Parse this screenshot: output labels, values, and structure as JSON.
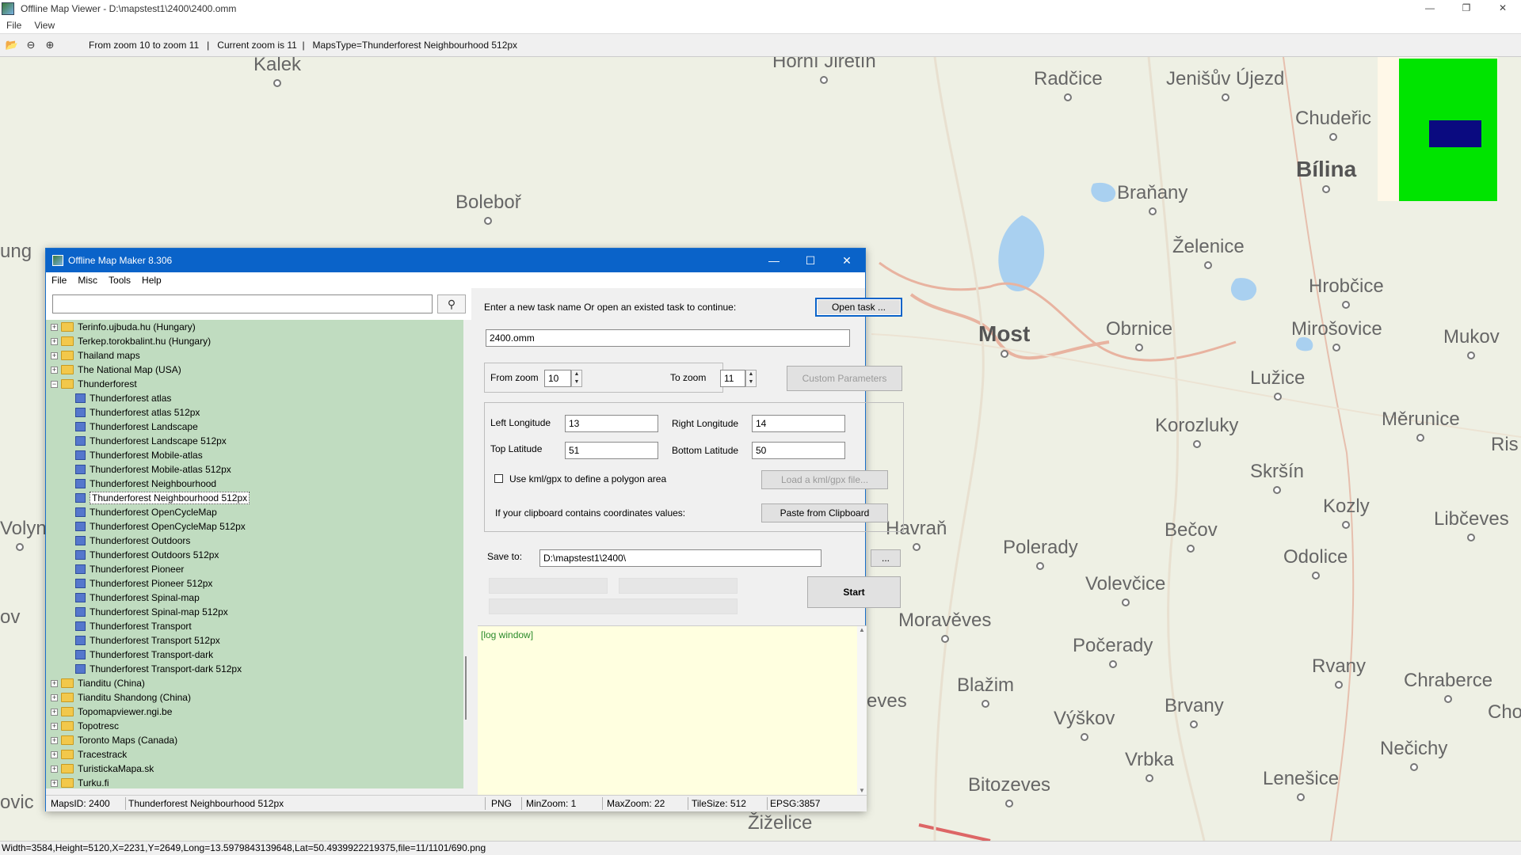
{
  "viewer": {
    "title": "Offline Map Viewer - D:\\mapstest1\\2400\\2400.omm",
    "menu": [
      "File",
      "View"
    ],
    "toolbar_status": "From zoom 10 to zoom 11   |   Current zoom is 11  |   MapsType=Thunderforest Neighbourhood 512px",
    "status_bar": "Width=3584,Height=5120,X=2231,Y=2649,Long=13.5979843139648,Lat=50.4939922219375,file=11/1101/690.png",
    "places": [
      {
        "name": "Kalek",
        "big": false
      },
      {
        "name": "Hořní Jiřetín",
        "big": false
      },
      {
        "name": "Radčice",
        "big": false
      },
      {
        "name": "Jenišův Újezd",
        "big": false
      },
      {
        "name": "Chudeřic",
        "big": false
      },
      {
        "name": "Bílina",
        "big": true
      },
      {
        "name": "Boleboř",
        "big": false
      },
      {
        "name": "Braňany",
        "big": false
      },
      {
        "name": "Želenice",
        "big": false
      },
      {
        "name": "Hrobčice",
        "big": false
      },
      {
        "name": "Most",
        "big": true
      },
      {
        "name": "Obrnice",
        "big": false
      },
      {
        "name": "Mirošovice",
        "big": false
      },
      {
        "name": "Mukov",
        "big": false
      },
      {
        "name": "Lužice",
        "big": false
      },
      {
        "name": "Korozluky",
        "big": false
      },
      {
        "name": "Měrunice",
        "big": false
      },
      {
        "name": "Skršín",
        "big": false
      },
      {
        "name": "Kozly",
        "big": false
      },
      {
        "name": "Havraň",
        "big": false
      },
      {
        "name": "Polerady",
        "big": false
      },
      {
        "name": "Bečov",
        "big": false
      },
      {
        "name": "Libčeves",
        "big": false
      },
      {
        "name": "Volevčice",
        "big": false
      },
      {
        "name": "Odolice",
        "big": false
      },
      {
        "name": "Moravěves",
        "big": false
      },
      {
        "name": "Počerady",
        "big": false
      },
      {
        "name": "Blažim",
        "big": false
      },
      {
        "name": "Rvany",
        "big": false
      },
      {
        "name": "Chraberce",
        "big": false
      },
      {
        "name": "Výškov",
        "big": false
      },
      {
        "name": "Brvany",
        "big": false
      },
      {
        "name": "Vrbka",
        "big": false
      },
      {
        "name": "Nečichy",
        "big": false
      },
      {
        "name": "Bitozeves",
        "big": false
      },
      {
        "name": "Lenešice",
        "big": false
      },
      {
        "name": "Žiželice",
        "big": false
      },
      {
        "name": "Volyn",
        "big": false
      },
      {
        "name": "ung",
        "big": false
      },
      {
        "name": "eves",
        "big": false
      },
      {
        "name": "Ris",
        "big": false
      },
      {
        "name": "Cho",
        "big": false
      },
      {
        "name": "ov",
        "big": false
      },
      {
        "name": "ovic",
        "big": false
      }
    ]
  },
  "maker": {
    "title": "Offline Map Maker 8.306",
    "menu": [
      "File",
      "Misc",
      "Tools",
      "Help"
    ],
    "search": {
      "value": "",
      "placeholder": ""
    },
    "tree": [
      {
        "label": "Terinfo.ujbuda.hu (Hungary)",
        "type": "folder",
        "exp": "+"
      },
      {
        "label": "Terkep.torokbalint.hu (Hungary)",
        "type": "folder",
        "exp": "+"
      },
      {
        "label": "Thailand maps",
        "type": "folder",
        "exp": "+"
      },
      {
        "label": "The National Map (USA)",
        "type": "folder",
        "exp": "+"
      },
      {
        "label": "Thunderforest",
        "type": "folder",
        "exp": "−"
      },
      {
        "label": "Thunderforest atlas",
        "type": "leaf"
      },
      {
        "label": "Thunderforest atlas 512px",
        "type": "leaf"
      },
      {
        "label": "Thunderforest Landscape",
        "type": "leaf"
      },
      {
        "label": "Thunderforest Landscape 512px",
        "type": "leaf"
      },
      {
        "label": "Thunderforest Mobile-atlas",
        "type": "leaf"
      },
      {
        "label": "Thunderforest Mobile-atlas 512px",
        "type": "leaf"
      },
      {
        "label": "Thunderforest Neighbourhood",
        "type": "leaf"
      },
      {
        "label": "Thunderforest Neighbourhood 512px",
        "type": "leaf",
        "selected": true
      },
      {
        "label": "Thunderforest OpenCycleMap",
        "type": "leaf"
      },
      {
        "label": "Thunderforest OpenCycleMap 512px",
        "type": "leaf"
      },
      {
        "label": "Thunderforest Outdoors",
        "type": "leaf"
      },
      {
        "label": "Thunderforest Outdoors 512px",
        "type": "leaf"
      },
      {
        "label": "Thunderforest Pioneer",
        "type": "leaf"
      },
      {
        "label": "Thunderforest Pioneer 512px",
        "type": "leaf"
      },
      {
        "label": "Thunderforest Spinal-map",
        "type": "leaf"
      },
      {
        "label": "Thunderforest Spinal-map 512px",
        "type": "leaf"
      },
      {
        "label": "Thunderforest Transport",
        "type": "leaf"
      },
      {
        "label": "Thunderforest Transport 512px",
        "type": "leaf"
      },
      {
        "label": "Thunderforest Transport-dark",
        "type": "leaf"
      },
      {
        "label": "Thunderforest Transport-dark 512px",
        "type": "leaf"
      },
      {
        "label": "Tianditu (China)",
        "type": "folder",
        "exp": "+"
      },
      {
        "label": "Tianditu Shandong (China)",
        "type": "folder",
        "exp": "+"
      },
      {
        "label": "Topomapviewer.ngi.be",
        "type": "folder",
        "exp": "+"
      },
      {
        "label": "Topotresc",
        "type": "folder",
        "exp": "+"
      },
      {
        "label": "Toronto Maps (Canada)",
        "type": "folder",
        "exp": "+"
      },
      {
        "label": "Tracestrack",
        "type": "folder",
        "exp": "+"
      },
      {
        "label": "TuristickaMapa.sk",
        "type": "folder",
        "exp": "+"
      },
      {
        "label": "Turku.fi",
        "type": "folder",
        "exp": "+"
      }
    ],
    "form": {
      "task_prompt": "Enter a new task name Or open an existed task to continue:",
      "open_task": "Open task ...",
      "task_name": "2400.omm",
      "from_zoom_label": "From zoom",
      "from_zoom": "10",
      "to_zoom_label": "To zoom",
      "to_zoom": "11",
      "custom_params": "Custom Parameters",
      "left_lon_label": "Left Longitude",
      "left_lon": "13",
      "right_lon_label": "Right Longitude",
      "right_lon": "14",
      "top_lat_label": "Top Latitude",
      "top_lat": "51",
      "bottom_lat_label": "Bottom Latitude",
      "bottom_lat": "50",
      "kml_label": "Use kml/gpx to define a polygon area",
      "kml_btn": "Load a kml/gpx file...",
      "clipboard_label": "If your clipboard contains coordinates values:",
      "clipboard_btn": "Paste from Clipboard",
      "save_label": "Save to:",
      "save_path": "D:\\mapstest1\\2400\\",
      "browse_btn": "...",
      "start_btn": "Start"
    },
    "log": "[log window]",
    "status": {
      "maps_id": "MapsID: 2400",
      "map_name": "Thunderforest Neighbourhood 512px",
      "format": "PNG",
      "min_zoom": "MinZoom: 1",
      "max_zoom": "MaxZoom: 22",
      "tile_size": "TileSize: 512",
      "epsg": "EPSG:3857"
    }
  },
  "colors": {
    "dialog_title": "#0a63c9",
    "tree_bg": "#c0dcc0",
    "log_bg": "#ffffe0",
    "map_bg": "#eef0e4",
    "minimap_green": "#00e400",
    "minimap_blue": "#0a0a80"
  }
}
